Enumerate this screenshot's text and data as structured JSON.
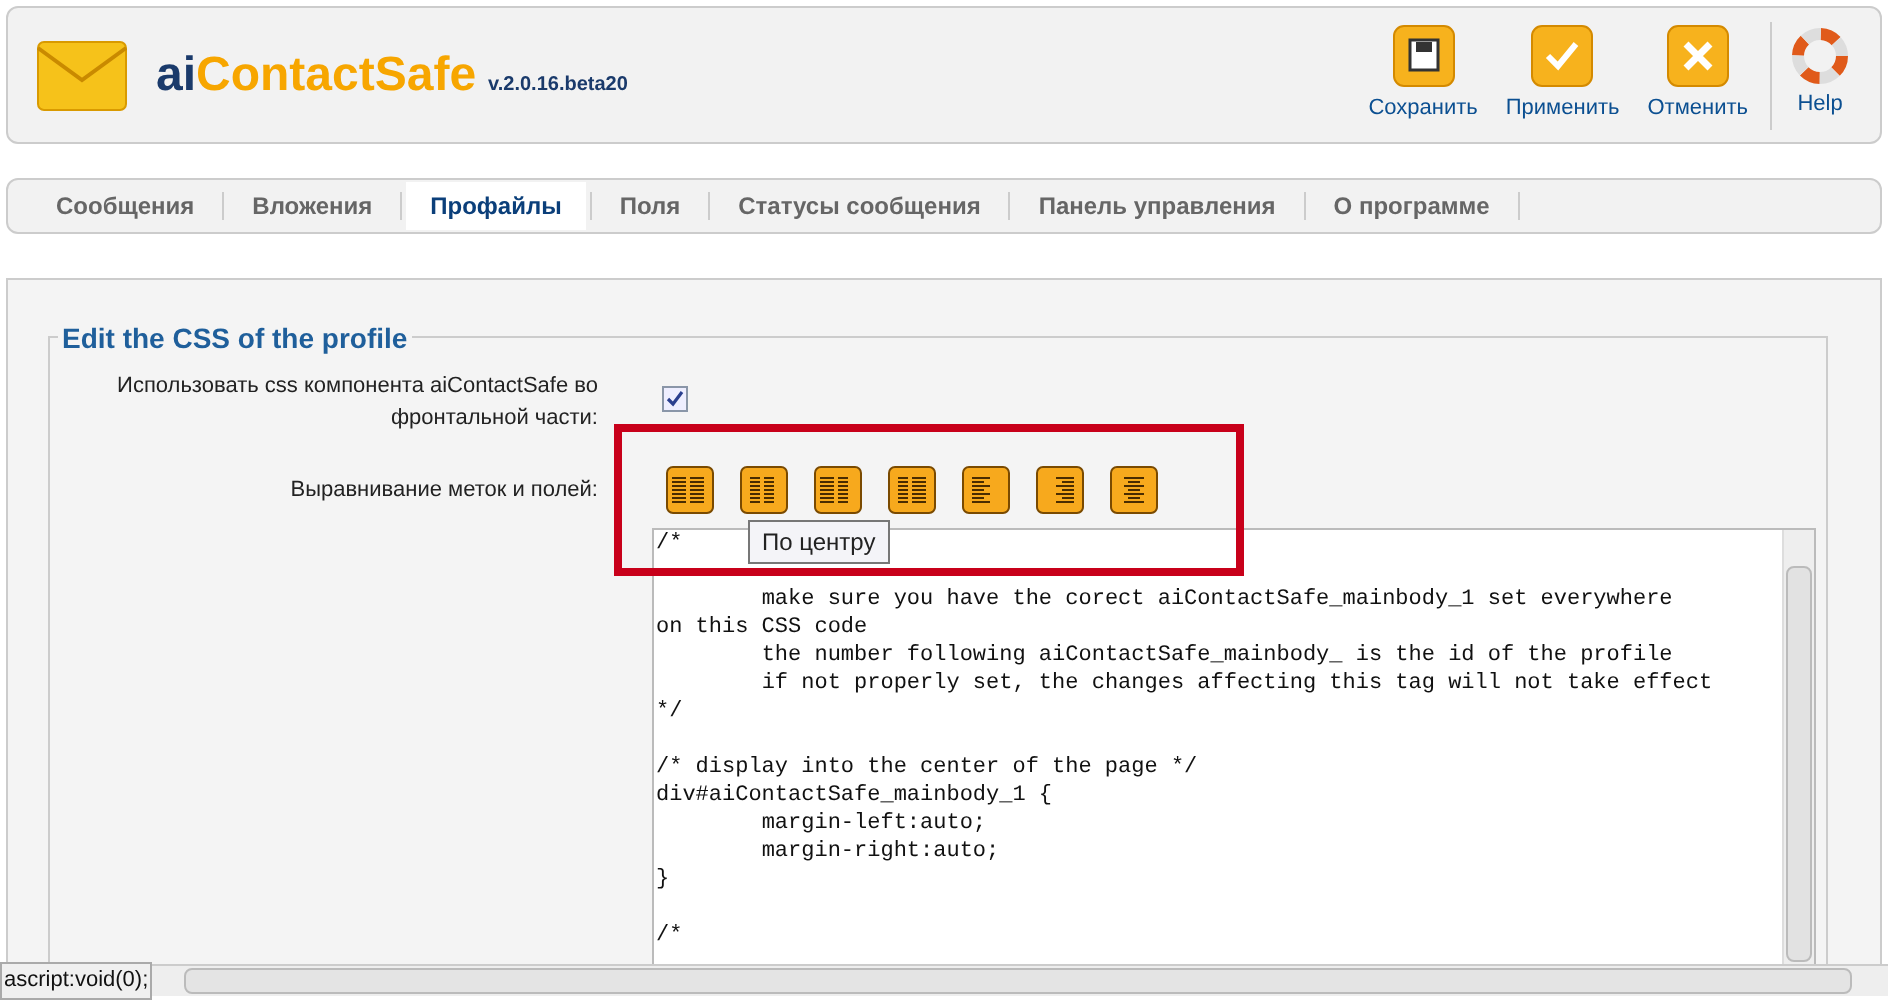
{
  "header": {
    "title_prefix": "ai",
    "title_main": "ContactSafe",
    "version": "v.2.0.16.beta20"
  },
  "toolbar": [
    {
      "label": "Сохранить",
      "kind": "save"
    },
    {
      "label": "Применить",
      "kind": "apply"
    },
    {
      "label": "Отменить",
      "kind": "cancel"
    },
    {
      "label": "Help",
      "kind": "help"
    }
  ],
  "tabs": [
    {
      "label": "Сообщения",
      "selected": false
    },
    {
      "label": "Вложения",
      "selected": false
    },
    {
      "label": "Профайлы",
      "selected": true
    },
    {
      "label": "Поля",
      "selected": false
    },
    {
      "label": "Статусы сообщения",
      "selected": false
    },
    {
      "label": "Панель управления",
      "selected": false
    },
    {
      "label": "О программе",
      "selected": false
    }
  ],
  "form": {
    "legend": "Edit the CSS of the profile",
    "use_css": {
      "label": "Использовать css компонента aiContactSafe во фронтальной части:",
      "checked": true
    },
    "alignment": {
      "label": "Выравнивание меток и полей:",
      "tooltip": "По центру"
    },
    "code": "/*\n\n\tmake sure you have the corect aiContactSafe_mainbody_1 set everywhere\non this CSS code\n\tthe number following aiContactSafe_mainbody_ is the id of the profile\n\tif not properly set, the changes affecting this tag will not take effect\n*/\n\n/* display into the center of the page */\ndiv#aiContactSafe_mainbody_1 {\n\tmargin-left:auto;\n\tmargin-right:auto;\n}\n\n/*"
  },
  "status_bar": {
    "text": "ascript:void(0);"
  }
}
